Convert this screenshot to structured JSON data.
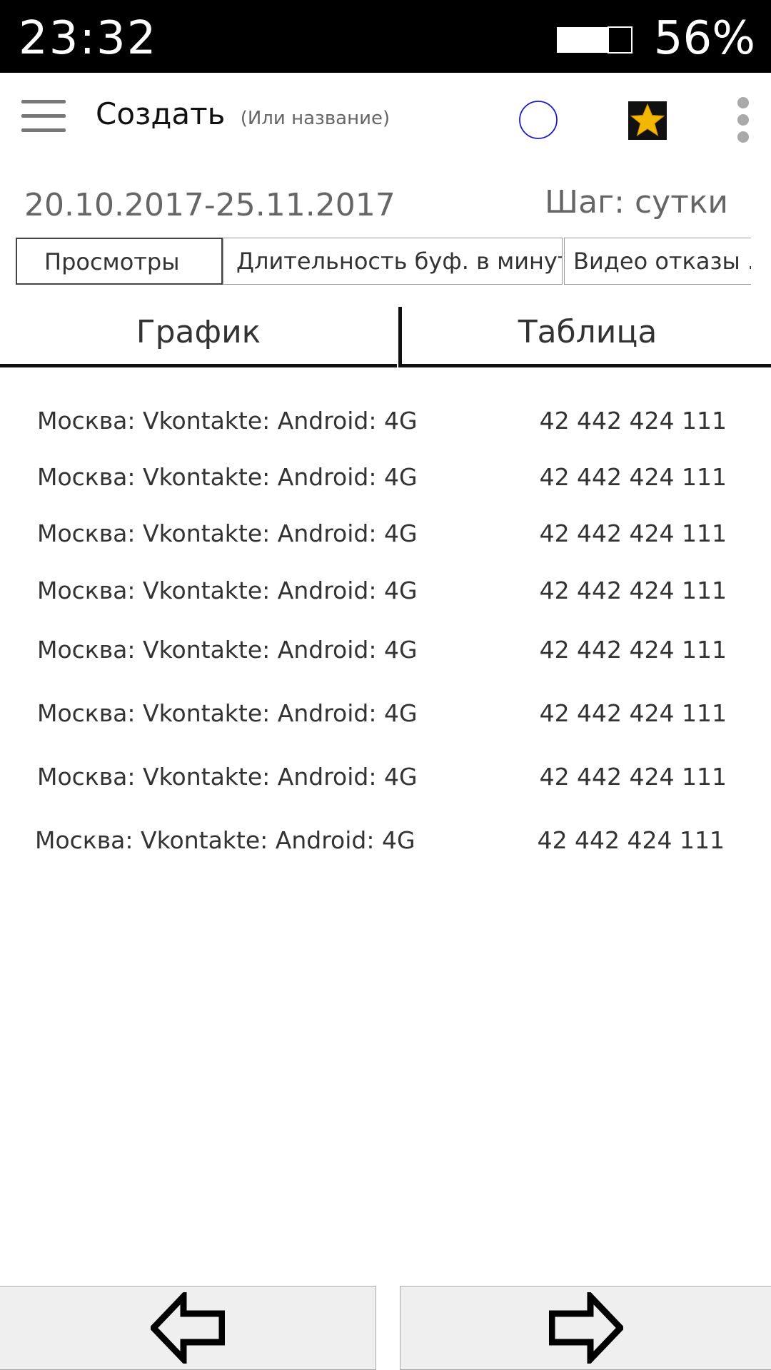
{
  "status_bar": {
    "time": "23:32",
    "battery": "56%"
  },
  "toolbar": {
    "title": "Создать",
    "subtitle": "(Или название)",
    "icons": [
      "menu-icon",
      "circle-icon",
      "star-icon",
      "more-vert-icon"
    ],
    "colors": {
      "circle": "#1a1acc",
      "star": "#f2b705",
      "star_bg": "#111111"
    }
  },
  "period": {
    "date_range": "20.10.2017-25.11.2017",
    "step": "Шаг: сутки"
  },
  "metric_tabs": [
    "Просмотры",
    "Длительность буф. в минуту",
    "Видео отказы ..."
  ],
  "view_tabs": {
    "graph": "График",
    "table": "Таблица",
    "active": "table"
  },
  "table": {
    "rows": [
      {
        "name": "Москва: Vkontakte: Android: 4G",
        "value": "42 442 424 111"
      },
      {
        "name": "Москва: Vkontakte: Android: 4G",
        "value": "42 442 424 111"
      },
      {
        "name": "Москва: Vkontakte: Android: 4G",
        "value": "42 442 424 111"
      },
      {
        "name": "Москва: Vkontakte: Android: 4G",
        "value": "42 442 424 111"
      },
      {
        "name": "Москва: Vkontakte: Android: 4G",
        "value": "42 442 424 111"
      },
      {
        "name": "Москва: Vkontakte: Android: 4G",
        "value": "42 442 424 111"
      },
      {
        "name": "Москва: Vkontakte: Android: 4G",
        "value": "42 442 424 111"
      },
      {
        "name": "Москва: Vkontakte: Android: 4G",
        "value": "42 442 424 111"
      }
    ]
  },
  "nav": {
    "back_icon": "arrow-left-icon",
    "forward_icon": "arrow-right-icon"
  }
}
